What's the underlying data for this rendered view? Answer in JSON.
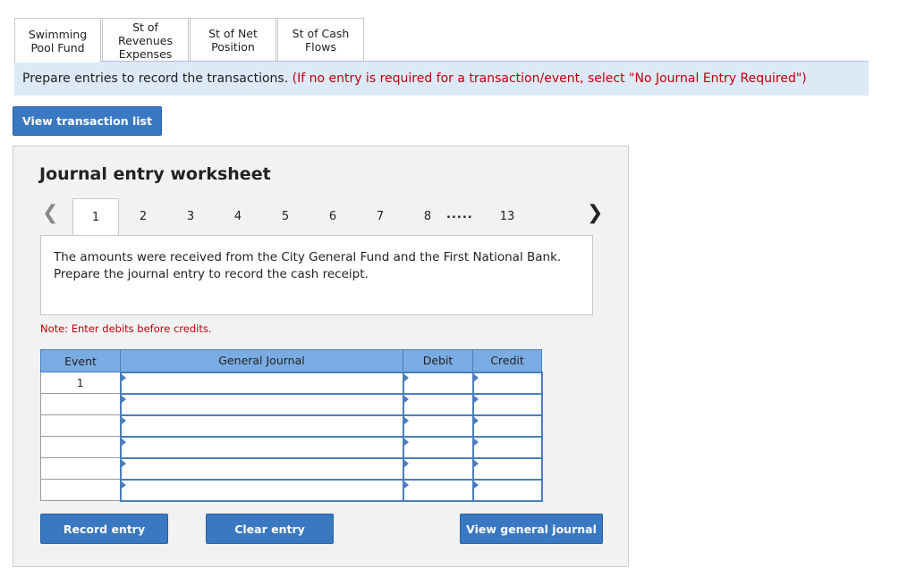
{
  "tabs": [
    {
      "label": "Swimming Pool Fund",
      "active": true
    },
    {
      "label": "St of Revenues Expenses",
      "active": false
    },
    {
      "label": "St of Net Position",
      "active": false
    },
    {
      "label": "St of Cash Flows",
      "active": false
    }
  ],
  "instruction": {
    "text": "Prepare entries to record the transactions.",
    "note": "(If no entry is required for a transaction/event, select \"No Journal Entry Required\")"
  },
  "view_transaction_list_label": "View transaction list",
  "worksheet": {
    "title": "Journal entry worksheet",
    "pager": {
      "prev_icon": "chevron-left-icon",
      "next_icon": "chevron-right-icon",
      "pages": [
        "1",
        "2",
        "3",
        "4",
        "5",
        "6",
        "7",
        "8"
      ],
      "ellipsis": ".....",
      "last_page": "13",
      "current_page": "1"
    },
    "description": "The amounts were received from the City General Fund and the First National Bank. Prepare the journal entry to record the cash receipt.",
    "note": "Note: Enter debits before credits.",
    "table": {
      "headers": [
        "Event",
        "General Journal",
        "Debit",
        "Credit"
      ],
      "rows": [
        {
          "event": "1",
          "account": "",
          "debit": "",
          "credit": ""
        },
        {
          "event": "",
          "account": "",
          "debit": "",
          "credit": ""
        },
        {
          "event": "",
          "account": "",
          "debit": "",
          "credit": ""
        },
        {
          "event": "",
          "account": "",
          "debit": "",
          "credit": ""
        },
        {
          "event": "",
          "account": "",
          "debit": "",
          "credit": ""
        },
        {
          "event": "",
          "account": "",
          "debit": "",
          "credit": ""
        }
      ]
    },
    "buttons": {
      "record": "Record entry",
      "clear": "Clear entry",
      "view_general_journal": "View general journal"
    }
  }
}
